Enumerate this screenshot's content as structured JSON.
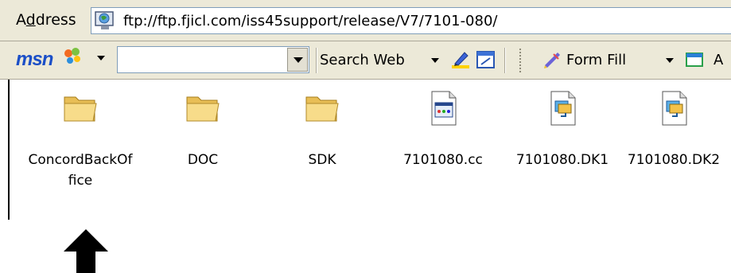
{
  "address": {
    "label_prefix": "A",
    "label_accel": "d",
    "label_suffix": "dress",
    "url": "ftp://ftp.fjicl.com/iss45support/release/V7/7101-080/"
  },
  "msnbar": {
    "logo": "msn",
    "search_value": "",
    "search_web_label": "Search Web",
    "form_fill_label": "Form Fill",
    "trailing_label": "A"
  },
  "files": [
    {
      "name": "ConcordBackOffice",
      "type": "folder"
    },
    {
      "name": "DOC",
      "type": "folder"
    },
    {
      "name": "SDK",
      "type": "folder"
    },
    {
      "name": "7101080.cc",
      "type": "document"
    },
    {
      "name": "7101080.DK1",
      "type": "dk-file"
    },
    {
      "name": "7101080.DK2",
      "type": "dk-file"
    }
  ],
  "colors": {
    "toolbar_bg": "#ece9d8",
    "folder": "#f4d67a",
    "msn_blue": "#1b4fc7"
  }
}
